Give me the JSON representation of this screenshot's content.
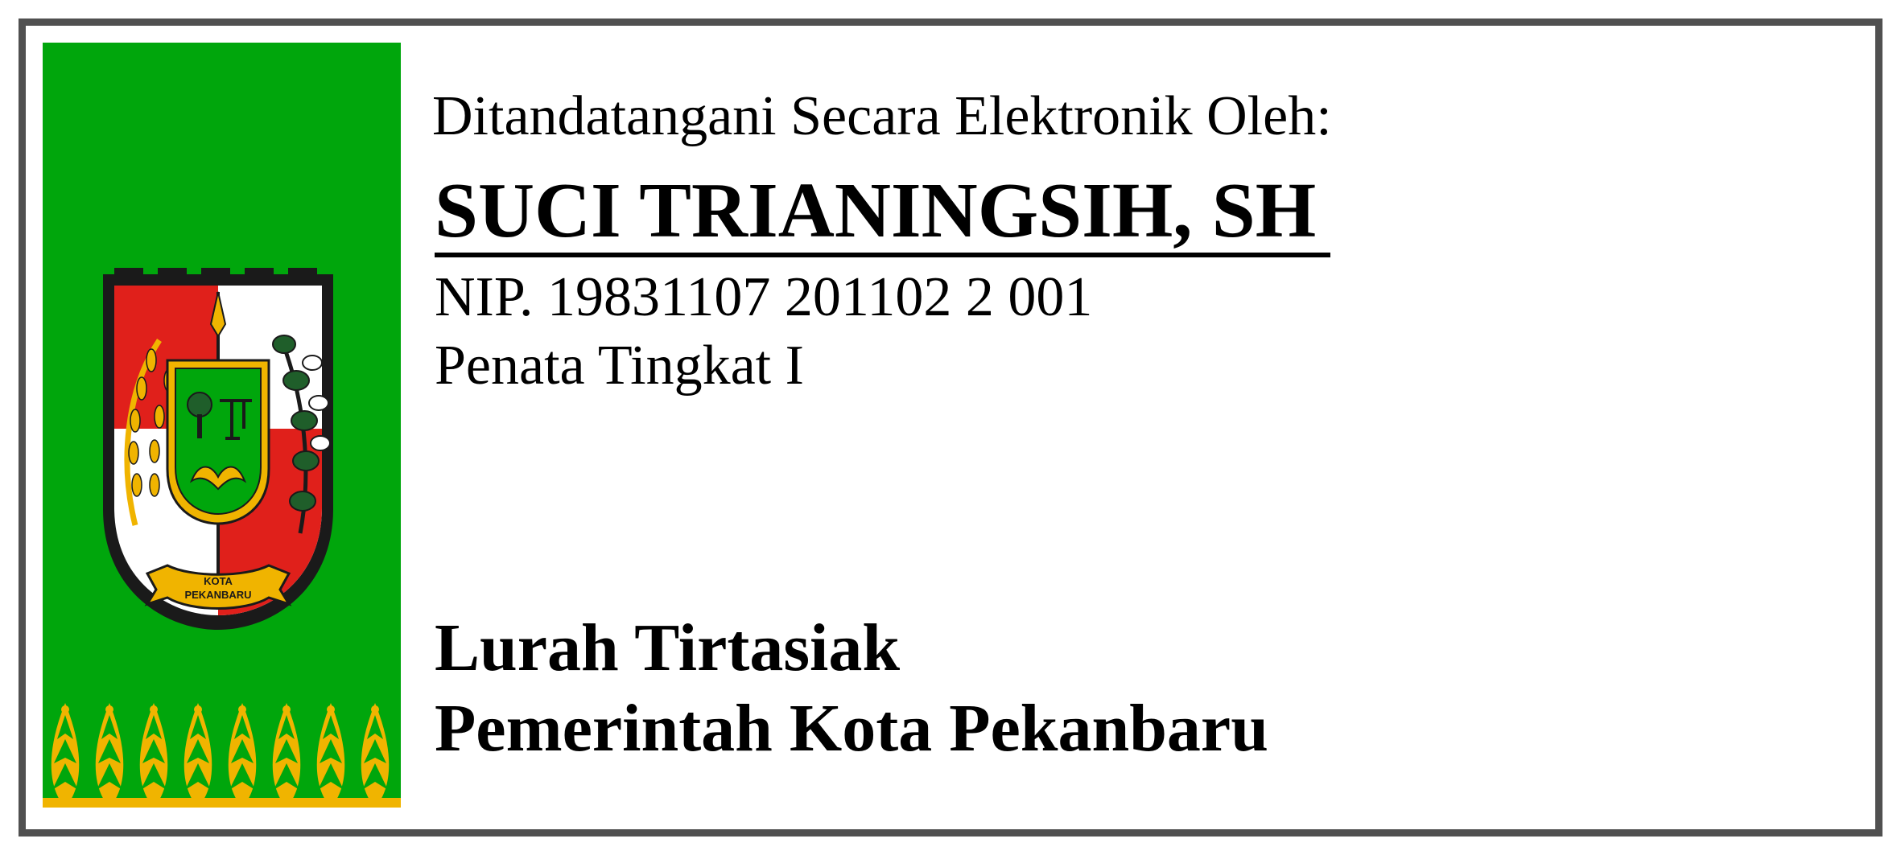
{
  "signature": {
    "signed_by_label": "Ditandatangani Secara Elektronik Oleh:",
    "name": "SUCI TRIANINGSIH, SH",
    "nip": "NIP. 19831107 201102 2 001",
    "rank": "Penata Tingkat I",
    "position": "Lurah Tirtasiak",
    "office": "Pemerintah Kota Pekanbaru"
  },
  "emblem": {
    "icon": "kota-pekanbaru-coat-of-arms-icon",
    "scroll_text_line1": "KOTA",
    "scroll_text_line2": "PEKANBARU"
  },
  "colors": {
    "banner_green": "#00a60c",
    "ornament_gold": "#f0b400",
    "shield_red": "#e0201b",
    "frame_gray": "#505050"
  }
}
